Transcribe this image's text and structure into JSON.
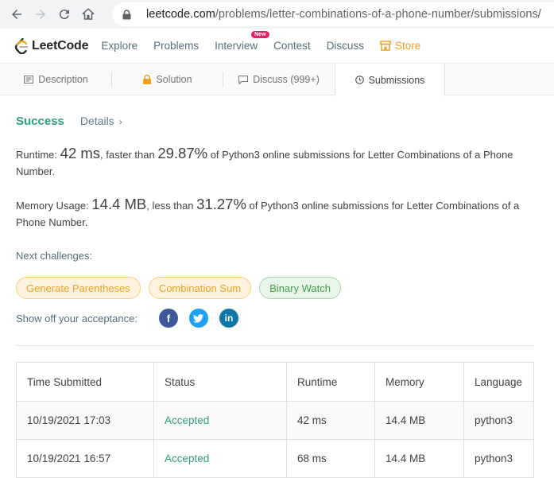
{
  "browser": {
    "url_host": "leetcode.com",
    "url_path": "/problems/letter-combinations-of-a-phone-number/submissions/"
  },
  "nav": {
    "logo_text": "LeetCode",
    "links": [
      "Explore",
      "Problems",
      "Interview",
      "Contest",
      "Discuss"
    ],
    "new_badge": "New",
    "store_label": "Store"
  },
  "tabs": {
    "description": "Description",
    "solution": "Solution",
    "discuss": "Discuss (999+)",
    "submissions": "Submissions"
  },
  "result": {
    "status": "Success",
    "details": "Details",
    "runtime_label": "Runtime:",
    "runtime_value": "42 ms",
    "runtime_mid": ", faster than",
    "runtime_percent": "29.87%",
    "runtime_tail": "of Python3 online submissions for Letter Combinations of a Phone Number.",
    "memory_label": "Memory Usage:",
    "memory_value": "14.4 MB",
    "memory_mid": ", less than",
    "memory_percent": "31.27%",
    "memory_tail": "of Python3 online submissions for Letter Combinations of a Phone Number."
  },
  "next": {
    "label": "Next challenges:",
    "challenges": [
      {
        "name": "Generate Parentheses",
        "difficulty": "medium"
      },
      {
        "name": "Combination Sum",
        "difficulty": "medium"
      },
      {
        "name": "Binary Watch",
        "difficulty": "easy"
      }
    ]
  },
  "share": {
    "label": "Show off your acceptance:",
    "icons": [
      "facebook-icon",
      "twitter-icon",
      "linkedin-icon"
    ]
  },
  "table": {
    "headers": [
      "Time Submitted",
      "Status",
      "Runtime",
      "Memory",
      "Language"
    ],
    "rows": [
      [
        "10/19/2021 17:03",
        "Accepted",
        "42 ms",
        "14.4 MB",
        "python3"
      ],
      [
        "10/19/2021 16:57",
        "Accepted",
        "68 ms",
        "14.4 MB",
        "python3"
      ]
    ]
  },
  "colors": {
    "accent_green": "#2e9f83",
    "medium_orange": "#f0a020",
    "easy_green": "#43a047"
  }
}
